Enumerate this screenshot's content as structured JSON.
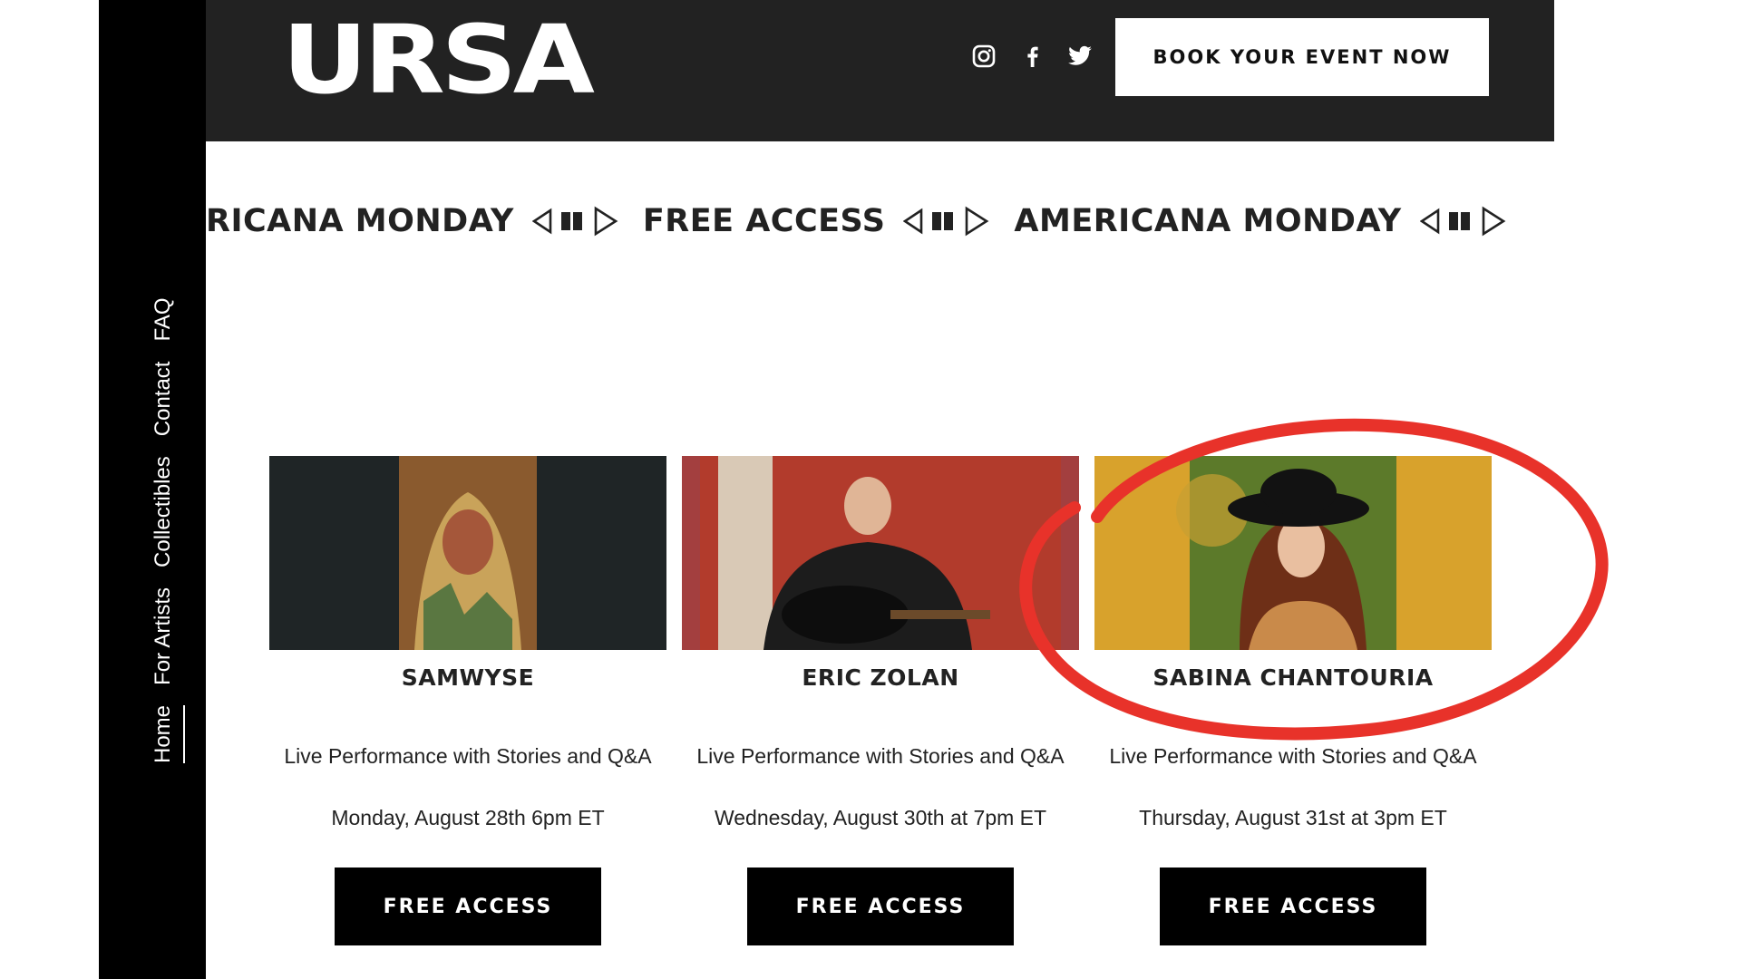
{
  "brand": {
    "logo": "URSA"
  },
  "nav": {
    "items": [
      {
        "label": "Home",
        "active": true
      },
      {
        "label": "For Artists",
        "active": false
      },
      {
        "label": "Collectibles",
        "active": false
      },
      {
        "label": "Contact",
        "active": false
      },
      {
        "label": "FAQ",
        "active": false
      }
    ]
  },
  "header": {
    "social_icons": [
      "instagram-icon",
      "facebook-icon",
      "twitter-icon"
    ],
    "book_button": "BOOK YOUR EVENT NOW"
  },
  "marquee": {
    "items": [
      "RICANA MONDAY",
      "FREE ACCESS",
      "AMERICANA MONDAY"
    ]
  },
  "events": [
    {
      "name": "SAMWYSE",
      "description": "Live Performance with Stories and Q&A",
      "date": "Monday, August 28th 6pm ET",
      "button": "FREE ACCESS",
      "frame_color": "#1f2526",
      "photo_color": "#8a5a2e"
    },
    {
      "name": "ERIC ZOLAN",
      "description": "Live Performance with Stories and Q&A",
      "date": "Wednesday, August 30th at 7pm ET",
      "button": "FREE ACCESS",
      "frame_color": "#a33f3f",
      "photo_color": "#b23b2c"
    },
    {
      "name": "SABINA CHANTOURIA",
      "description": "Live Performance with Stories and Q&A",
      "date": "Thursday, August 31st at 3pm ET",
      "button": "FREE ACCESS",
      "frame_color": "#d8a22c",
      "photo_color": "#5c7a2a"
    }
  ],
  "colors": {
    "header_bg": "#222222",
    "sidebar_bg": "#000000",
    "annotation_red": "#e8322a"
  }
}
